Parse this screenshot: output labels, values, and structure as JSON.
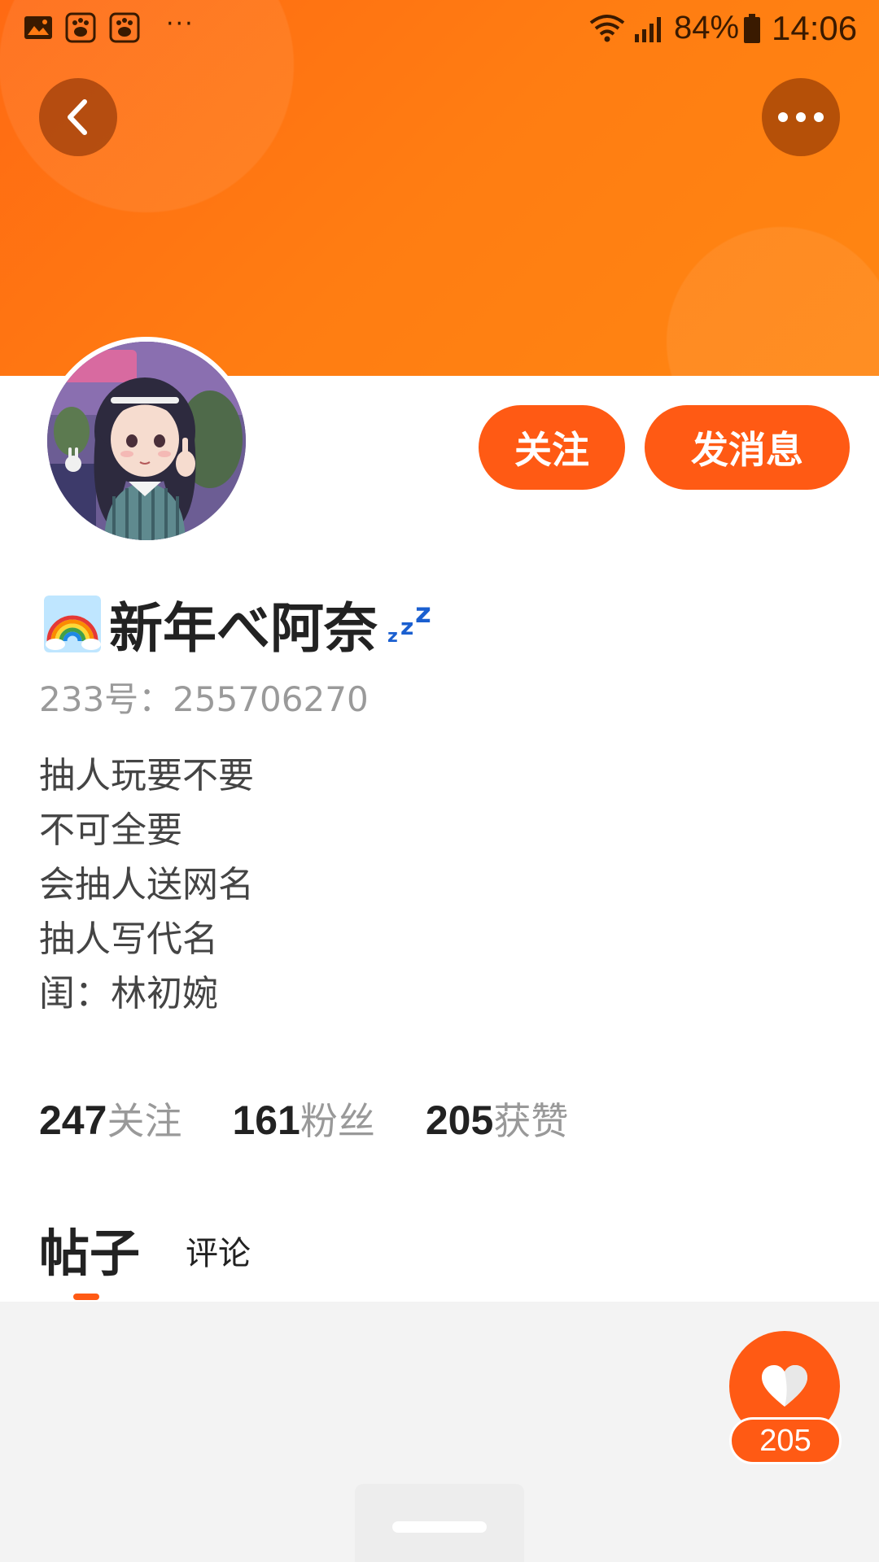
{
  "status_bar": {
    "battery_percent": "84%",
    "time": "14:06",
    "more_indicator": "···",
    "icons": [
      "gallery-icon",
      "baidu-paw-icon",
      "baidu-paw-icon",
      "wifi-icon",
      "signal-icon",
      "battery-icon"
    ]
  },
  "header": {
    "back_icon": "chevron-left-icon",
    "more_icon": "more-horizontal-icon"
  },
  "profile": {
    "name": "新年べ阿奈",
    "name_prefix_icon": "rainbow-icon",
    "name_suffix_icon": "zzz-sleep-icon",
    "user_id": "233号：255706270",
    "bio": [
      "抽人玩要不要",
      "不可全要",
      "会抽人送网名",
      "抽人写代名",
      "闺：林初婉"
    ]
  },
  "actions": {
    "follow_label": "关注",
    "message_label": "发消息"
  },
  "stats": [
    {
      "value": "247",
      "label": "关注"
    },
    {
      "value": "161",
      "label": "粉丝"
    },
    {
      "value": "205",
      "label": "获赞"
    }
  ],
  "tabs": {
    "posts_label": "帖子",
    "comments_label": "评论",
    "active": "posts"
  },
  "like_fab": {
    "icon": "heart-icon",
    "count": "205"
  },
  "colors": {
    "brand_orange": "#ff5a14",
    "banner_orange": "#ff7a12",
    "content_bg": "#f3f3f3"
  }
}
